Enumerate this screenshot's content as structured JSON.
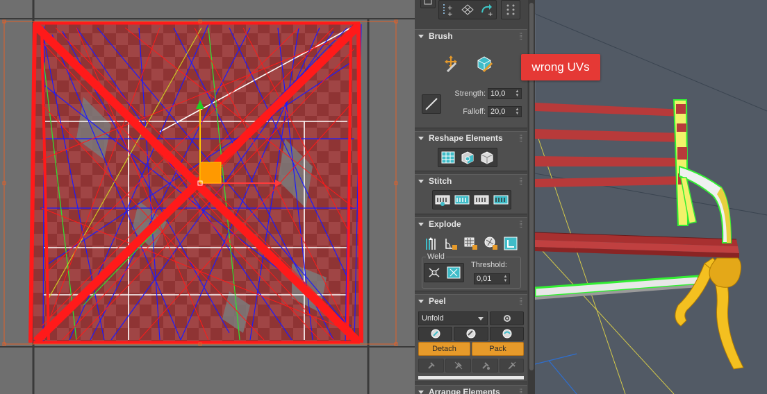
{
  "callout": {
    "text": "wrong UVs",
    "color": "#e53935"
  },
  "colors": {
    "uv_edge": "#ff1a1a",
    "uv_seam": "#1a1aff",
    "uv_green": "#33dd33",
    "accent_orange": "#e69a2a",
    "gizmo_y": "#22cc22",
    "gizmo_x": "#ff3b3b"
  },
  "panel": {
    "brush": {
      "title": "Brush",
      "icons": [
        "move-brush-icon",
        "relax-brush-icon",
        "line-tool-icon"
      ],
      "strength_label": "Strength:",
      "strength_value": "10,0",
      "falloff_label": "Falloff:",
      "falloff_value": "20,0"
    },
    "reshape": {
      "title": "Reshape Elements",
      "icons": [
        "grid-straighten-icon",
        "relax-cube-icon",
        "relax-sphere-icon"
      ]
    },
    "stitch": {
      "title": "Stitch",
      "icons": [
        "stitch-custom-icon",
        "stitch-target-icon",
        "stitch-average-icon",
        "stitch-source-icon"
      ]
    },
    "explode": {
      "title": "Explode",
      "icons": [
        "break-icon",
        "flatten-by-angle-icon",
        "flatten-by-polygon-icon",
        "flatten-by-smoothing-icon",
        "flatten-custom-icon"
      ],
      "weld_label": "Weld",
      "threshold_label": "Threshold:",
      "threshold_value": "0,01",
      "weld_icons": [
        "weld-selected-icon",
        "weld-all-icon"
      ]
    },
    "peel": {
      "title": "Peel",
      "mode": "Unfold",
      "detach_label": "Detach",
      "pack_label": "Pack",
      "icons": [
        "settings-icon",
        "lscm-icon",
        "reset-peel-icon",
        "peel-mode-icon"
      ],
      "pin_icons": [
        "pin-icon",
        "unpin-icon",
        "pin-auto-icon",
        "invert-pin-icon"
      ]
    },
    "arrange": {
      "title": "Arrange Elements"
    }
  }
}
